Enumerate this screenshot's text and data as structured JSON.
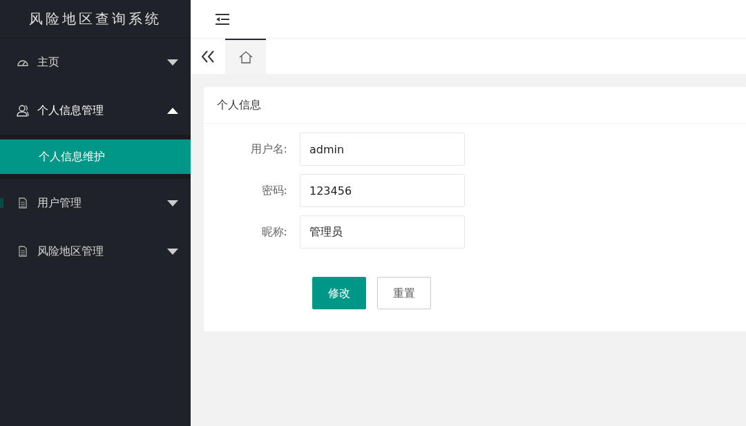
{
  "app": {
    "title": "风险地区查询系统"
  },
  "sidebar": {
    "items": [
      {
        "label": "主页",
        "expanded": false
      },
      {
        "label": "个人信息管理",
        "expanded": true,
        "children": [
          {
            "label": "个人信息维护",
            "selected": true
          }
        ]
      },
      {
        "label": "用户管理",
        "expanded": false
      },
      {
        "label": "风险地区管理",
        "expanded": false
      }
    ]
  },
  "tabs": [
    {
      "selected": true
    }
  ],
  "panel": {
    "title": "个人信息",
    "fields": [
      {
        "label": "用户名:",
        "value": "admin"
      },
      {
        "label": "密码:",
        "value": "123456"
      },
      {
        "label": "昵称:",
        "value": "管理员"
      }
    ],
    "buttons": [
      {
        "label": "修改",
        "kind": "primary"
      },
      {
        "label": "重置",
        "kind": "default"
      }
    ]
  }
}
